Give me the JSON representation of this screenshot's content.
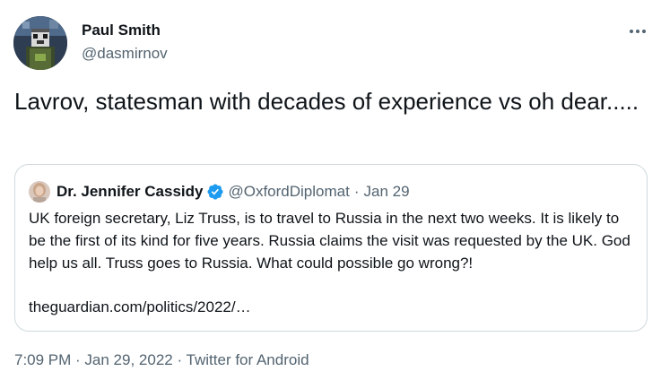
{
  "author": {
    "name": "Paul Smith",
    "handle": "@dasmirnov"
  },
  "tweet": {
    "text": "Lavrov, statesman with decades of experience vs oh dear....."
  },
  "quoted": {
    "name": "Dr. Jennifer Cassidy",
    "handle": "@OxfordDiplomat",
    "separator": "·",
    "date": "Jan 29",
    "text": "UK foreign secretary, Liz Truss, is to travel to Russia in the next two weeks. It is likely to be the first of its kind for five years. Russia claims the visit was requested by the UK. God help us all. Truss goes to Russia. What could possible go wrong?!",
    "link": "theguardian.com/politics/2022/…"
  },
  "meta": {
    "time": "7:09 PM",
    "sep1": " · ",
    "date": "Jan 29, 2022",
    "sep2": " · ",
    "source": "Twitter for Android"
  },
  "colors": {
    "text_primary": "#0f1419",
    "text_secondary": "#536471",
    "border": "#cfd9de",
    "verified_blue": "#1d9bf0"
  },
  "icons": {
    "more": "more-horizontal-icon",
    "verified": "verified-badge-icon"
  }
}
